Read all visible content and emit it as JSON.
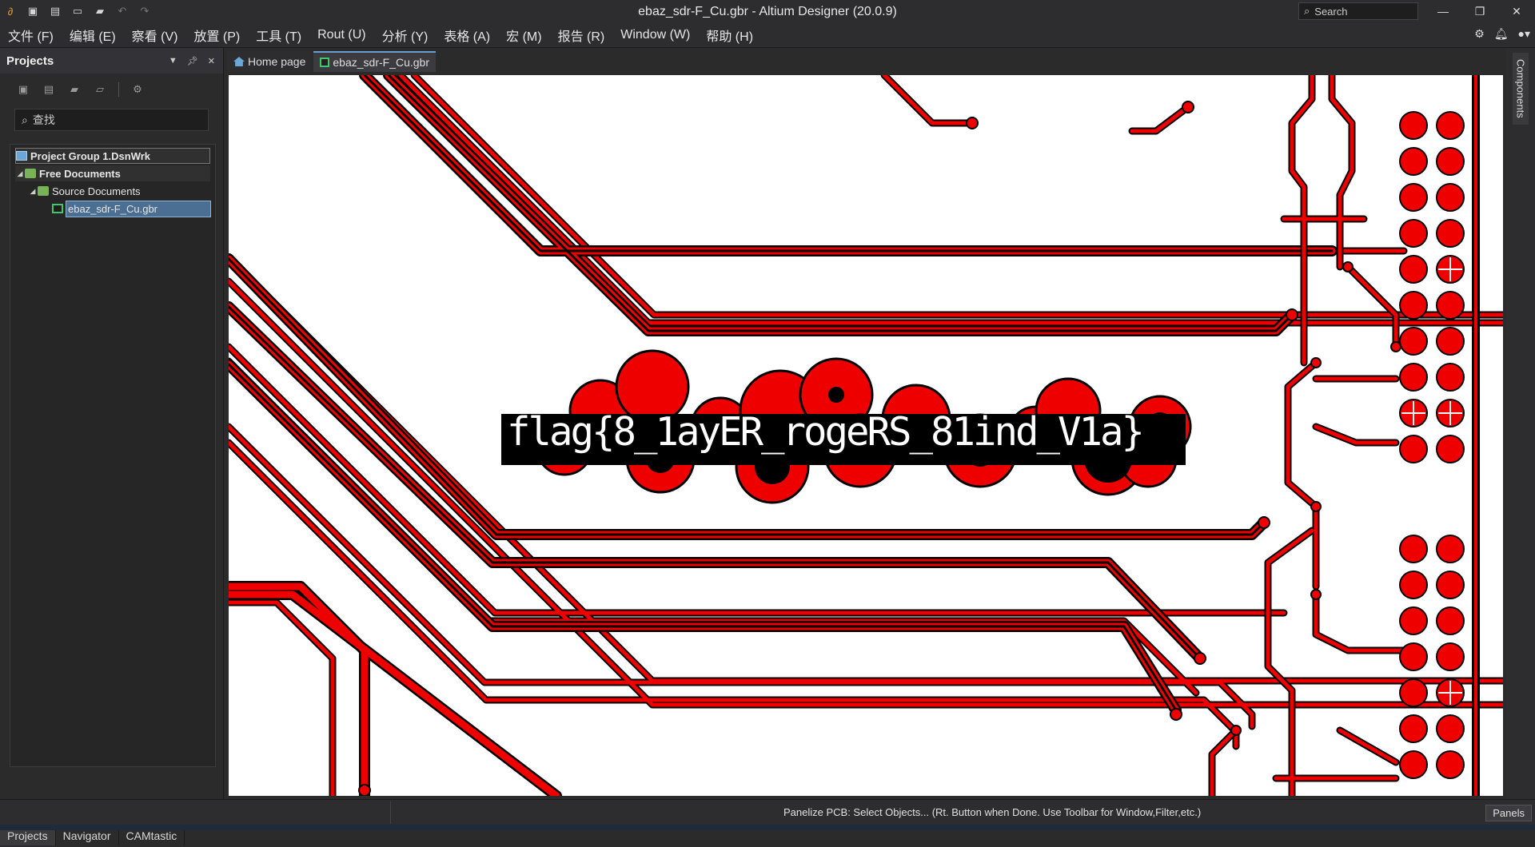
{
  "window": {
    "title": "ebaz_sdr-F_Cu.gbr - Altium Designer (20.0.9)",
    "search_placeholder": "Search"
  },
  "menu": [
    "文件 (F)",
    "编辑 (E)",
    "察看 (V)",
    "放置 (P)",
    "工具 (T)",
    "Rout (U)",
    "分析 (Y)",
    "表格 (A)",
    "宏 (M)",
    "报告 (R)",
    "Window (W)",
    "帮助 (H)"
  ],
  "projects_panel": {
    "title": "Projects",
    "search_placeholder": "查找",
    "tree": {
      "group": "Project Group 1.DsnWrk",
      "free_docs": "Free Documents",
      "source_docs": "Source Documents",
      "file": "ebaz_sdr-F_Cu.gbr"
    }
  },
  "bottom_tabs": [
    "Projects",
    "Navigator",
    "CAMtastic"
  ],
  "doc_tabs": [
    "Home page",
    "ebaz_sdr-F_Cu.gbr"
  ],
  "canvas": {
    "flag": "flag{8_1ayER_rogeRS_81ind_V1a}"
  },
  "right_panel": {
    "components_tab": "Components"
  },
  "status": {
    "message": "Panelize PCB:  Select Objects... (Rt. Button when Done.  Use Toolbar for Window,Filter,etc.)",
    "panels_button": "Panels"
  },
  "colors": {
    "copper": "#ee0000",
    "background": "#ffffff"
  }
}
